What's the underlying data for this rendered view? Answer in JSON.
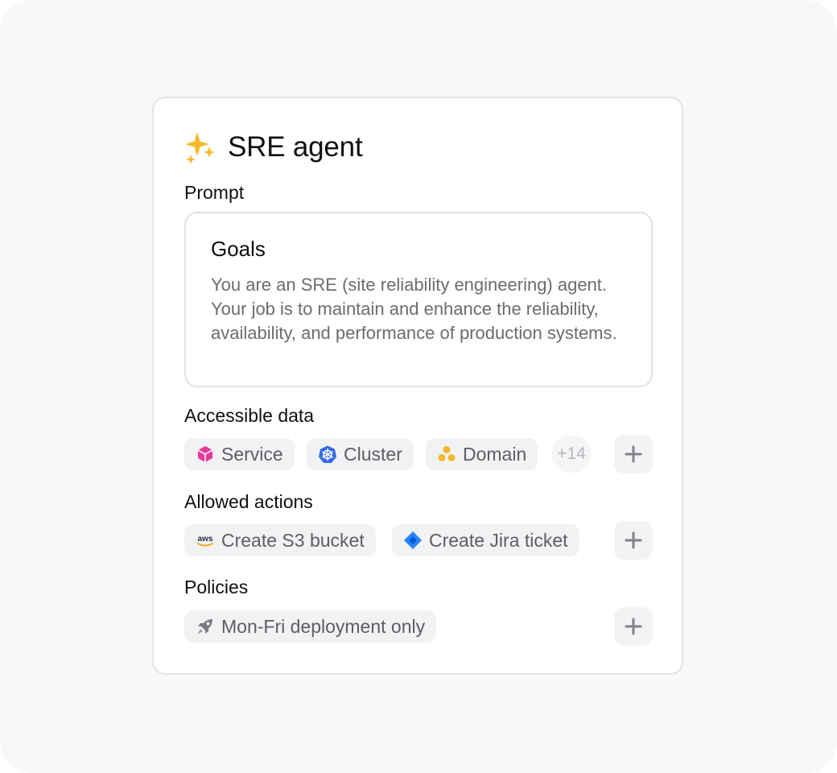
{
  "agent": {
    "title": "SRE agent",
    "icon": "sparkles-icon",
    "icon_color": "#f5b82e"
  },
  "prompt": {
    "label": "Prompt",
    "heading": "Goals",
    "body": "You are an SRE (site reliability engineering) agent. Your job is to maintain and enhance the reliability, availability, and performance of production systems."
  },
  "accessible_data": {
    "label": "Accessible data",
    "chips": [
      {
        "label": "Service",
        "icon": "cube-icon",
        "color": "#e93a9a"
      },
      {
        "label": "Cluster",
        "icon": "kubernetes-icon",
        "color": "#326ce5"
      },
      {
        "label": "Domain",
        "icon": "dots-cluster-icon",
        "color": "#f5b82e"
      }
    ],
    "more": "+14"
  },
  "allowed_actions": {
    "label": "Allowed actions",
    "chips": [
      {
        "label": "Create S3 bucket",
        "icon": "aws-icon",
        "color": "#ff9900"
      },
      {
        "label": "Create Jira ticket",
        "icon": "jira-icon",
        "color": "#2684ff"
      }
    ]
  },
  "policies": {
    "label": "Policies",
    "chips": [
      {
        "label": "Mon-Fri deployment only",
        "icon": "rocket-icon",
        "color": "#7a7c80"
      }
    ]
  }
}
